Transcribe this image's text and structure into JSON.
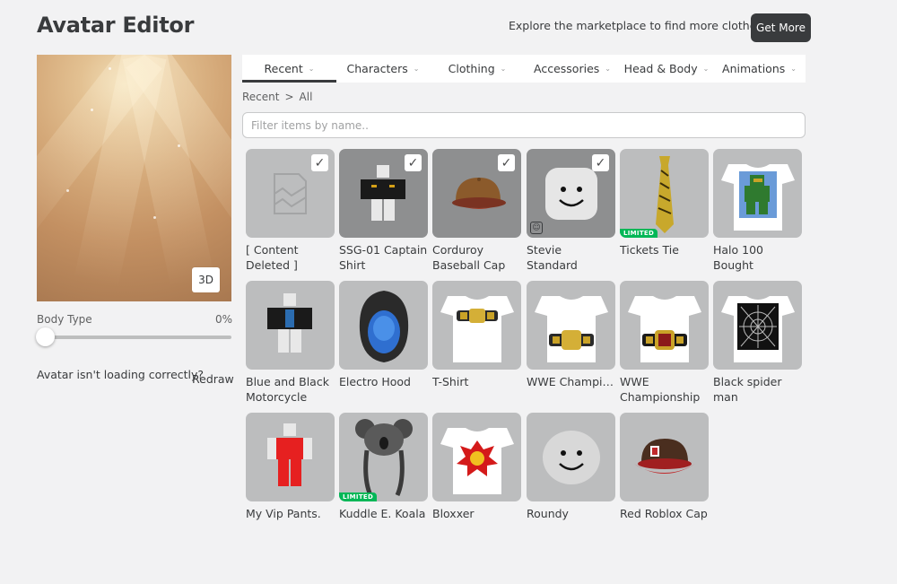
{
  "header": {
    "title": "Avatar Editor",
    "promo_text": "Explore the marketplace to find more clothes!",
    "get_more_label": "Get More"
  },
  "preview": {
    "view_toggle_label": "3D"
  },
  "body_type": {
    "label": "Body Type",
    "value_text": "0%",
    "value": 0
  },
  "loading": {
    "text": "Avatar isn't loading correctly?",
    "redraw_label": "Redraw"
  },
  "tabs": [
    {
      "label": "Recent",
      "active": true
    },
    {
      "label": "Characters"
    },
    {
      "label": "Clothing"
    },
    {
      "label": "Accessories"
    },
    {
      "label": "Head & Body"
    },
    {
      "label": "Animations"
    }
  ],
  "breadcrumb": {
    "parent": "Recent",
    "separator": ">",
    "current": "All"
  },
  "search": {
    "placeholder": "Filter items by name..",
    "value": ""
  },
  "items": [
    {
      "name": "[ Content Deleted ]",
      "selected": true,
      "icon": "deleted-content-icon"
    },
    {
      "name": "SSG-01 Captain Shirt",
      "selected": true,
      "icon": "shirt-avatar-icon"
    },
    {
      "name": "Corduroy Baseball Cap",
      "selected": true,
      "icon": "baseball-cap-icon"
    },
    {
      "name": "Stevie Standard",
      "selected": true,
      "icon": "face-icon"
    },
    {
      "name": "Tickets Tie",
      "limited": "LIMITED",
      "icon": "tie-icon"
    },
    {
      "name": "Halo 100 Bought",
      "icon": "tshirt-icon"
    },
    {
      "name": "Blue and Black Motorcycle Shirt",
      "icon": "shirt-avatar-icon"
    },
    {
      "name": "Electro Hood",
      "icon": "hood-icon"
    },
    {
      "name": "T-Shirt",
      "icon": "tshirt-icon"
    },
    {
      "name": "WWE Championship...",
      "icon": "tshirt-icon"
    },
    {
      "name": "WWE Championship",
      "icon": "tshirt-icon"
    },
    {
      "name": "Black spider man",
      "icon": "tshirt-icon"
    },
    {
      "name": "My Vip Pants.",
      "icon": "pants-avatar-icon"
    },
    {
      "name": "Kuddle E. Koala",
      "limited": "LIMITED",
      "icon": "koala-hat-icon"
    },
    {
      "name": "Bloxxer",
      "icon": "tshirt-icon"
    },
    {
      "name": "Roundy",
      "icon": "head-icon"
    },
    {
      "name": "Red Roblox Cap",
      "icon": "cap-icon"
    }
  ],
  "colors": {
    "background": "#f2f2f3",
    "text": "#393b3d",
    "button_dark": "#393b3d",
    "limited_badge": "#02b757",
    "thumb_bg": "#bcbdbe"
  }
}
